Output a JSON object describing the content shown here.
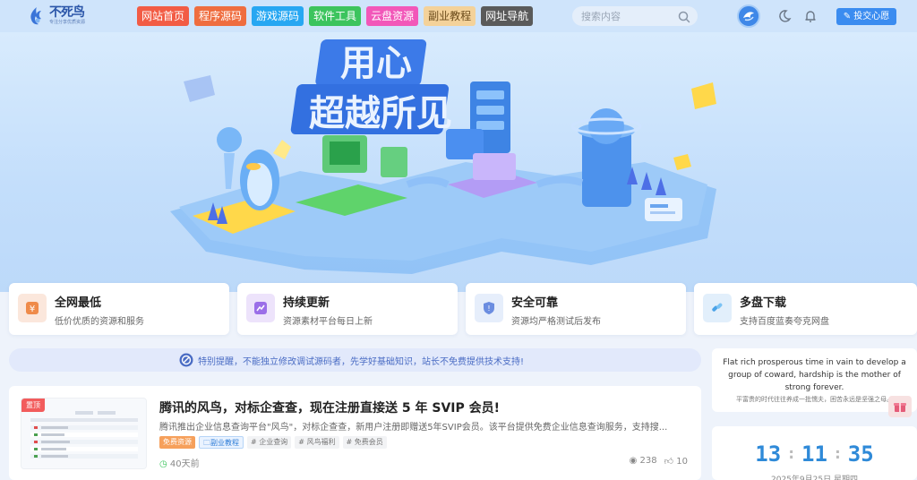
{
  "header": {
    "logo": {
      "name": "不死鸟",
      "slogan": "专注分享优质资源"
    },
    "nav": [
      {
        "label": "网站首页",
        "color": "#f25c45"
      },
      {
        "label": "程序源码",
        "color": "#ef6d3f"
      },
      {
        "label": "游戏源码",
        "color": "#27a7f2"
      },
      {
        "label": "软件工具",
        "color": "#3cc45d"
      },
      {
        "label": "云盘资源",
        "color": "#f257b9"
      },
      {
        "label": "副业教程",
        "color": "#f4d29a"
      },
      {
        "label": "网址导航",
        "color": "#5a5a5a"
      }
    ],
    "search_placeholder": "搜索内容",
    "submit_label": "投交心愿",
    "icons": [
      "moon-icon",
      "bell-icon",
      "search-icon",
      "pencil-icon"
    ]
  },
  "banner": {
    "headline_line1": "用心",
    "headline_line2": "超越所见"
  },
  "features": [
    {
      "title": "全网最低",
      "desc": "低价优质的资源和服务",
      "icon": "yen-icon",
      "icon_color": "#fbe7dc",
      "icon_fg": "#ef8b4a"
    },
    {
      "title": "持续更新",
      "desc": "资源素材平台每日上新",
      "icon": "chart-icon",
      "icon_color": "#ede3fb",
      "icon_fg": "#9b6ee8"
    },
    {
      "title": "安全可靠",
      "desc": "资源均严格测试后发布",
      "icon": "shield-icon",
      "icon_color": "#e6eefb",
      "icon_fg": "#6b8de0"
    },
    {
      "title": "多盘下载",
      "desc": "支持百度蓝奏夸克网盘",
      "icon": "link-icon",
      "icon_color": "#e2effb",
      "icon_fg": "#4aa3e8"
    }
  ],
  "notice": {
    "text": "特别提醒，不能独立修改调试源码者，先学好基础知识，站长不免费提供技术支持!"
  },
  "post": {
    "badge": "置顶",
    "title": "腾讯的风鸟，对标企查查，现在注册直接送 5 年 SVIP 会员!",
    "excerpt": "腾讯推出企业信息查询平台\"风鸟\"，对标企查查，新用户注册即赠送5年SVIP会员。该平台提供免费企业信息查询服务，支持搜...",
    "tags": [
      {
        "label": "免费资源",
        "style": "orange"
      },
      {
        "label": "副业教程",
        "style": "blue"
      },
      {
        "label": "# 企业查询",
        "style": "gray"
      },
      {
        "label": "# 风鸟福利",
        "style": "gray"
      },
      {
        "label": "# 免费会员",
        "style": "gray"
      }
    ],
    "time": "40天前",
    "views": "238",
    "likes": "10"
  },
  "quote": {
    "en": "Flat rich prosperous time in vain to develop a group of coward, hardship is the mother of strong forever.",
    "cn": "平富贵的时代往往养成一批懦夫，困苦永远是坚强之母。"
  },
  "clock": {
    "hours": "13",
    "minutes": "11",
    "seconds": "35",
    "date": "2025年9月25日 星期四"
  }
}
